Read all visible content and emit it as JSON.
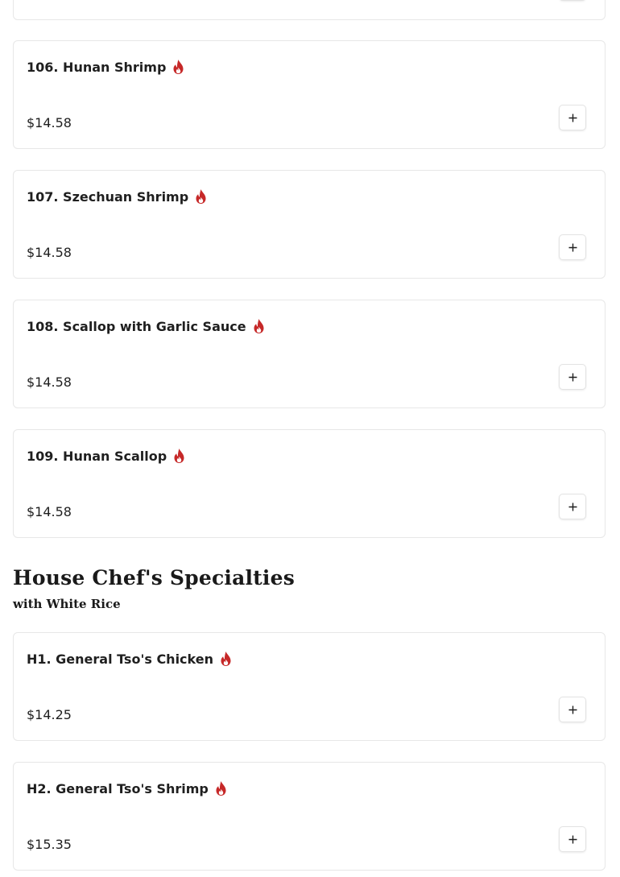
{
  "menu": {
    "items_above": [
      {
        "name": "106. Hunan Shrimp",
        "price": "$14.58",
        "spicy": true
      },
      {
        "name": "107. Szechuan Shrimp",
        "price": "$14.58",
        "spicy": true
      },
      {
        "name": "108. Scallop with Garlic Sauce",
        "price": "$14.58",
        "spicy": true
      },
      {
        "name": "109. Hunan Scallop",
        "price": "$14.58",
        "spicy": true
      }
    ],
    "section": {
      "title": "House Chef's Specialties",
      "subtitle": "with White Rice"
    },
    "items_below": [
      {
        "name": "H1. General Tso's Chicken",
        "price": "$14.25",
        "spicy": true
      },
      {
        "name": "H2. General Tso's Shrimp",
        "price": "$15.35",
        "spicy": true
      }
    ]
  },
  "icons": {
    "flame": "flame-icon",
    "plus": "plus-icon"
  },
  "colors": {
    "spicy_accent": "#c62828",
    "border": "#e7e7e7",
    "text": "#1f1f1f"
  }
}
